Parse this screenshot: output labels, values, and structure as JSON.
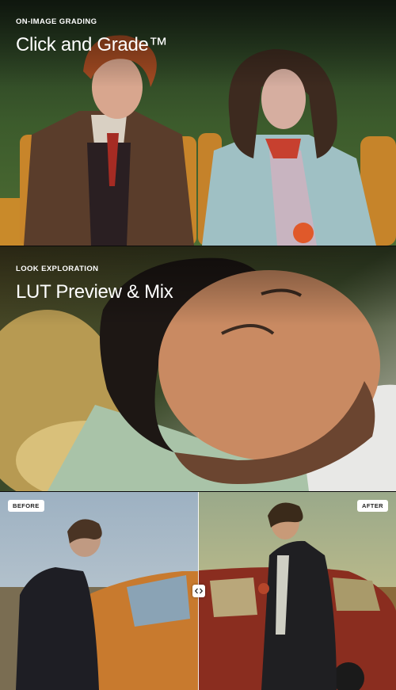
{
  "sections": [
    {
      "overline": "ON-IMAGE GRADING",
      "title": "Click and Grade™"
    },
    {
      "overline": "LOOK EXPLORATION",
      "title": "LUT Preview & Mix"
    }
  ],
  "compare": {
    "before_label": "BEFORE",
    "after_label": "AFTER",
    "handle_icon": "left-right-arrows-icon"
  }
}
